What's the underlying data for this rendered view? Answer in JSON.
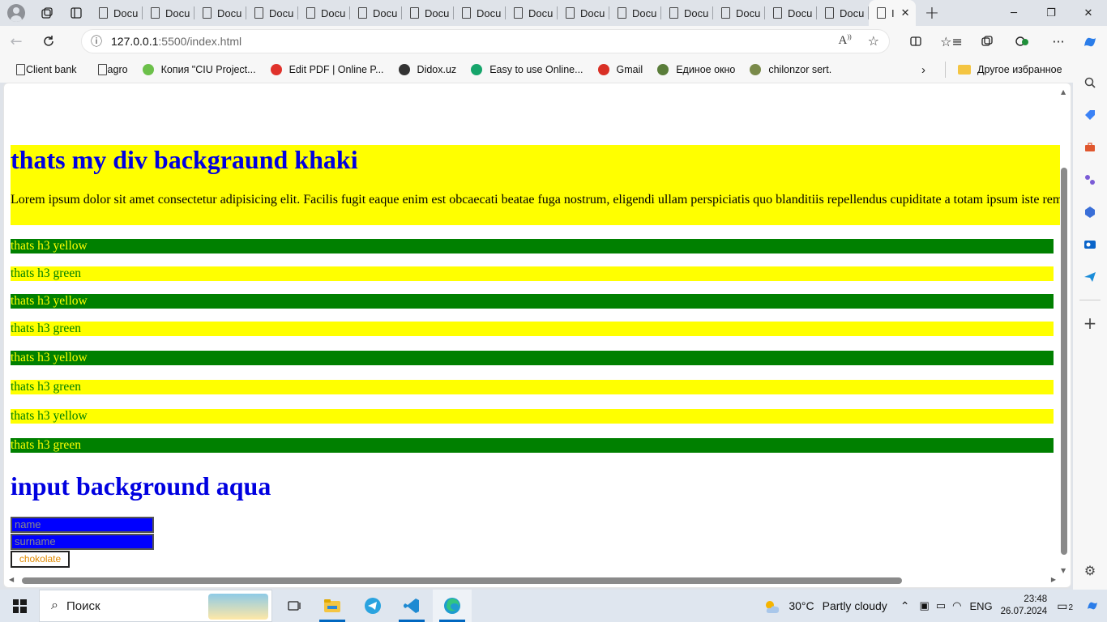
{
  "browser": {
    "tabs": [
      {
        "label": "Docu"
      },
      {
        "label": "Docu"
      },
      {
        "label": "Docu"
      },
      {
        "label": "Docu"
      },
      {
        "label": "Docu"
      },
      {
        "label": "Docu"
      },
      {
        "label": "Docu"
      },
      {
        "label": "Docu"
      },
      {
        "label": "Docu"
      },
      {
        "label": "Docu"
      },
      {
        "label": "Docu"
      },
      {
        "label": "Docu"
      },
      {
        "label": "Docu"
      },
      {
        "label": "Docu"
      },
      {
        "label": "Docu"
      },
      {
        "label": "Docu"
      }
    ],
    "active_tab_label": "I",
    "url_host": "127.0.0.1",
    "url_path": ":5500/index.html",
    "bookmarks": [
      {
        "label": "Client bank",
        "icon": "page-icon"
      },
      {
        "label": "agro",
        "icon": "page-icon"
      },
      {
        "label": "Копия \"CIU Project...",
        "icon": "diamond-icon"
      },
      {
        "label": "Edit PDF | Online P...",
        "icon": "heart-icon"
      },
      {
        "label": "Didox.uz",
        "icon": "doc-icon"
      },
      {
        "label": "Easy to use Online...",
        "icon": "s-icon"
      },
      {
        "label": "Gmail",
        "icon": "gmail-icon"
      },
      {
        "label": "Единое окно",
        "icon": "emblem-icon"
      },
      {
        "label": "chilonzor sert.",
        "icon": "globe-icon"
      }
    ],
    "other_bookmarks": "Другое избранное"
  },
  "page": {
    "khaki_heading": "thats my div backgraund khaki",
    "khaki_paragraph": "Lorem ipsum dolor sit amet consectetur adipisicing elit. Facilis fugit eaque enim est obcaecati beatae fuga nostrum, eligendi ullam perspiciatis quo blanditiis repellendus cupiditate a totam ipsum iste rem",
    "rows": [
      {
        "text": "thats h3 yellow",
        "style": "green-bg"
      },
      {
        "text": "thats h3 green",
        "style": "yellow-bg"
      },
      {
        "text": "thats h3 yellow",
        "style": "green-bg"
      },
      {
        "text": "thats h3 green",
        "style": "yellow-bg"
      },
      {
        "text": "thats h3 yellow",
        "style": "green-bg"
      },
      {
        "text": "thats h3 green",
        "style": "yellow-bg"
      },
      {
        "text": "thats h3 yellow",
        "style": "yellow-bg"
      },
      {
        "text": "thats h3 green",
        "style": "green-bg"
      }
    ],
    "input_heading": "input background aqua",
    "name_placeholder": "name",
    "surname_placeholder": "surname",
    "button_label": "chokolate"
  },
  "taskbar": {
    "search_placeholder": "Поиск",
    "temperature": "30°C",
    "weather": "Partly cloudy",
    "language": "ENG",
    "time": "23:48",
    "date": "26.07.2024",
    "notification_count": "2"
  },
  "colors": {
    "heading_blue": "#0000e0",
    "yellow": "#ffff00",
    "green": "#008000",
    "input_blue": "#0000ff",
    "button_text": "#e08a00"
  }
}
